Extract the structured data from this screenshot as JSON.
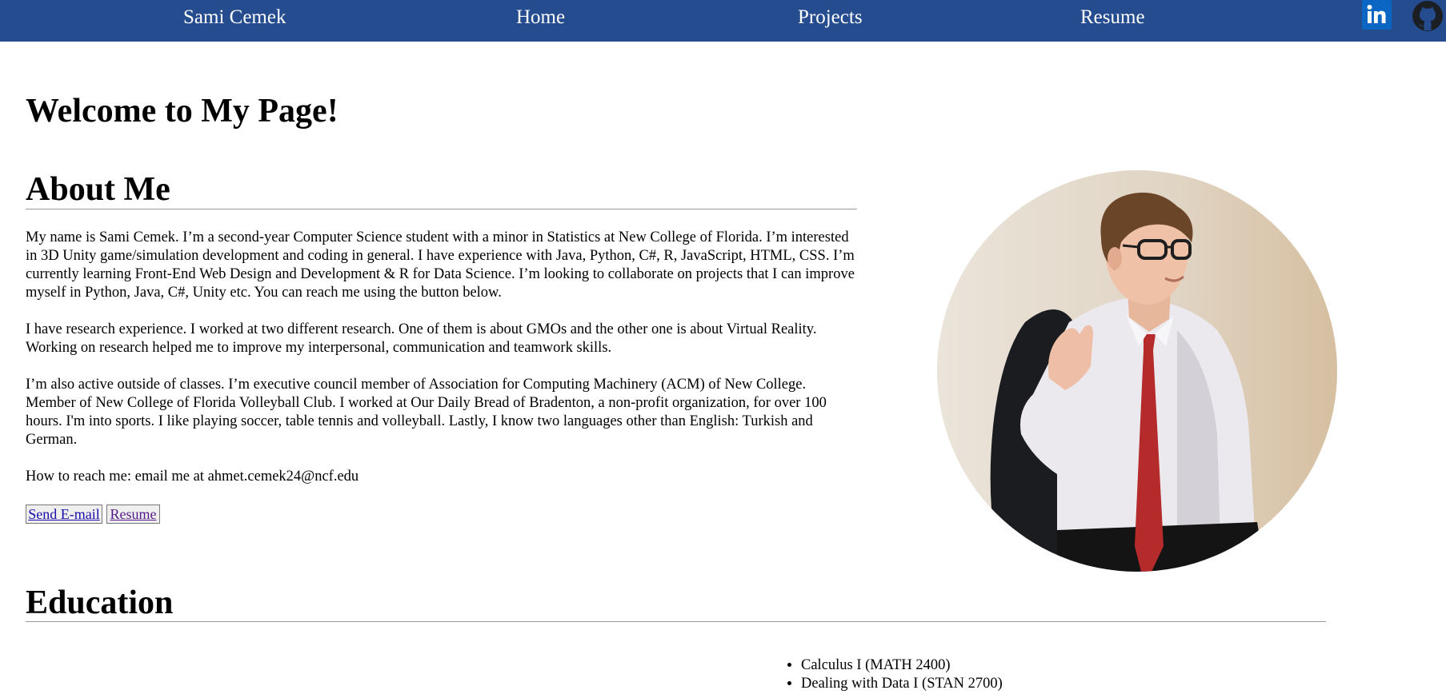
{
  "nav": {
    "brand": "Sami Cemek",
    "home": "Home",
    "projects": "Projects",
    "resume": "Resume",
    "linkedin_icon": "linkedin-icon",
    "github_icon": "github-icon",
    "bar_color": "#254c8f"
  },
  "main": {
    "title": "Welcome to My Page!",
    "about": {
      "heading": "About Me",
      "p1": "My name is Sami Cemek. I’m a second-year Computer Science student with a minor in Statistics at New College of Florida. I’m interested in 3D Unity game/simulation development and coding in general. I have experience with Java, Python, C#, R, JavaScript, HTML, CSS. I’m currently learning Front-End Web Design and Development & R for Data Science. I’m looking to collaborate on projects that I can improve myself in Python, Java, C#, Unity etc. You can reach me using the button below.",
      "p2": "I have research experience. I worked at two different research. One of them is about GMOs and the other one is about Virtual Reality. Working on research helped me to improve my interpersonal, communication and teamwork skills.",
      "p3": "I’m also active outside of classes. I’m executive council member of Association for Computing Machinery (ACM) of New College. Member of New College of Florida Volleyball Club. I worked at Our Daily Bread of Bradenton, a non-profit organization, for over 100 hours. I'm into sports. I like playing soccer, table tennis and volleyball. Lastly, I know two languages other than English: Turkish and German.",
      "p4": "How to reach me: email me at ahmet.cemek24@ncf.edu",
      "email_button": "Send E-mail",
      "resume_button": "Resume"
    },
    "education": {
      "heading": "Education",
      "courses": [
        "Calculus I (MATH 2400)",
        "Dealing with Data I (STAN 2700)"
      ]
    }
  }
}
